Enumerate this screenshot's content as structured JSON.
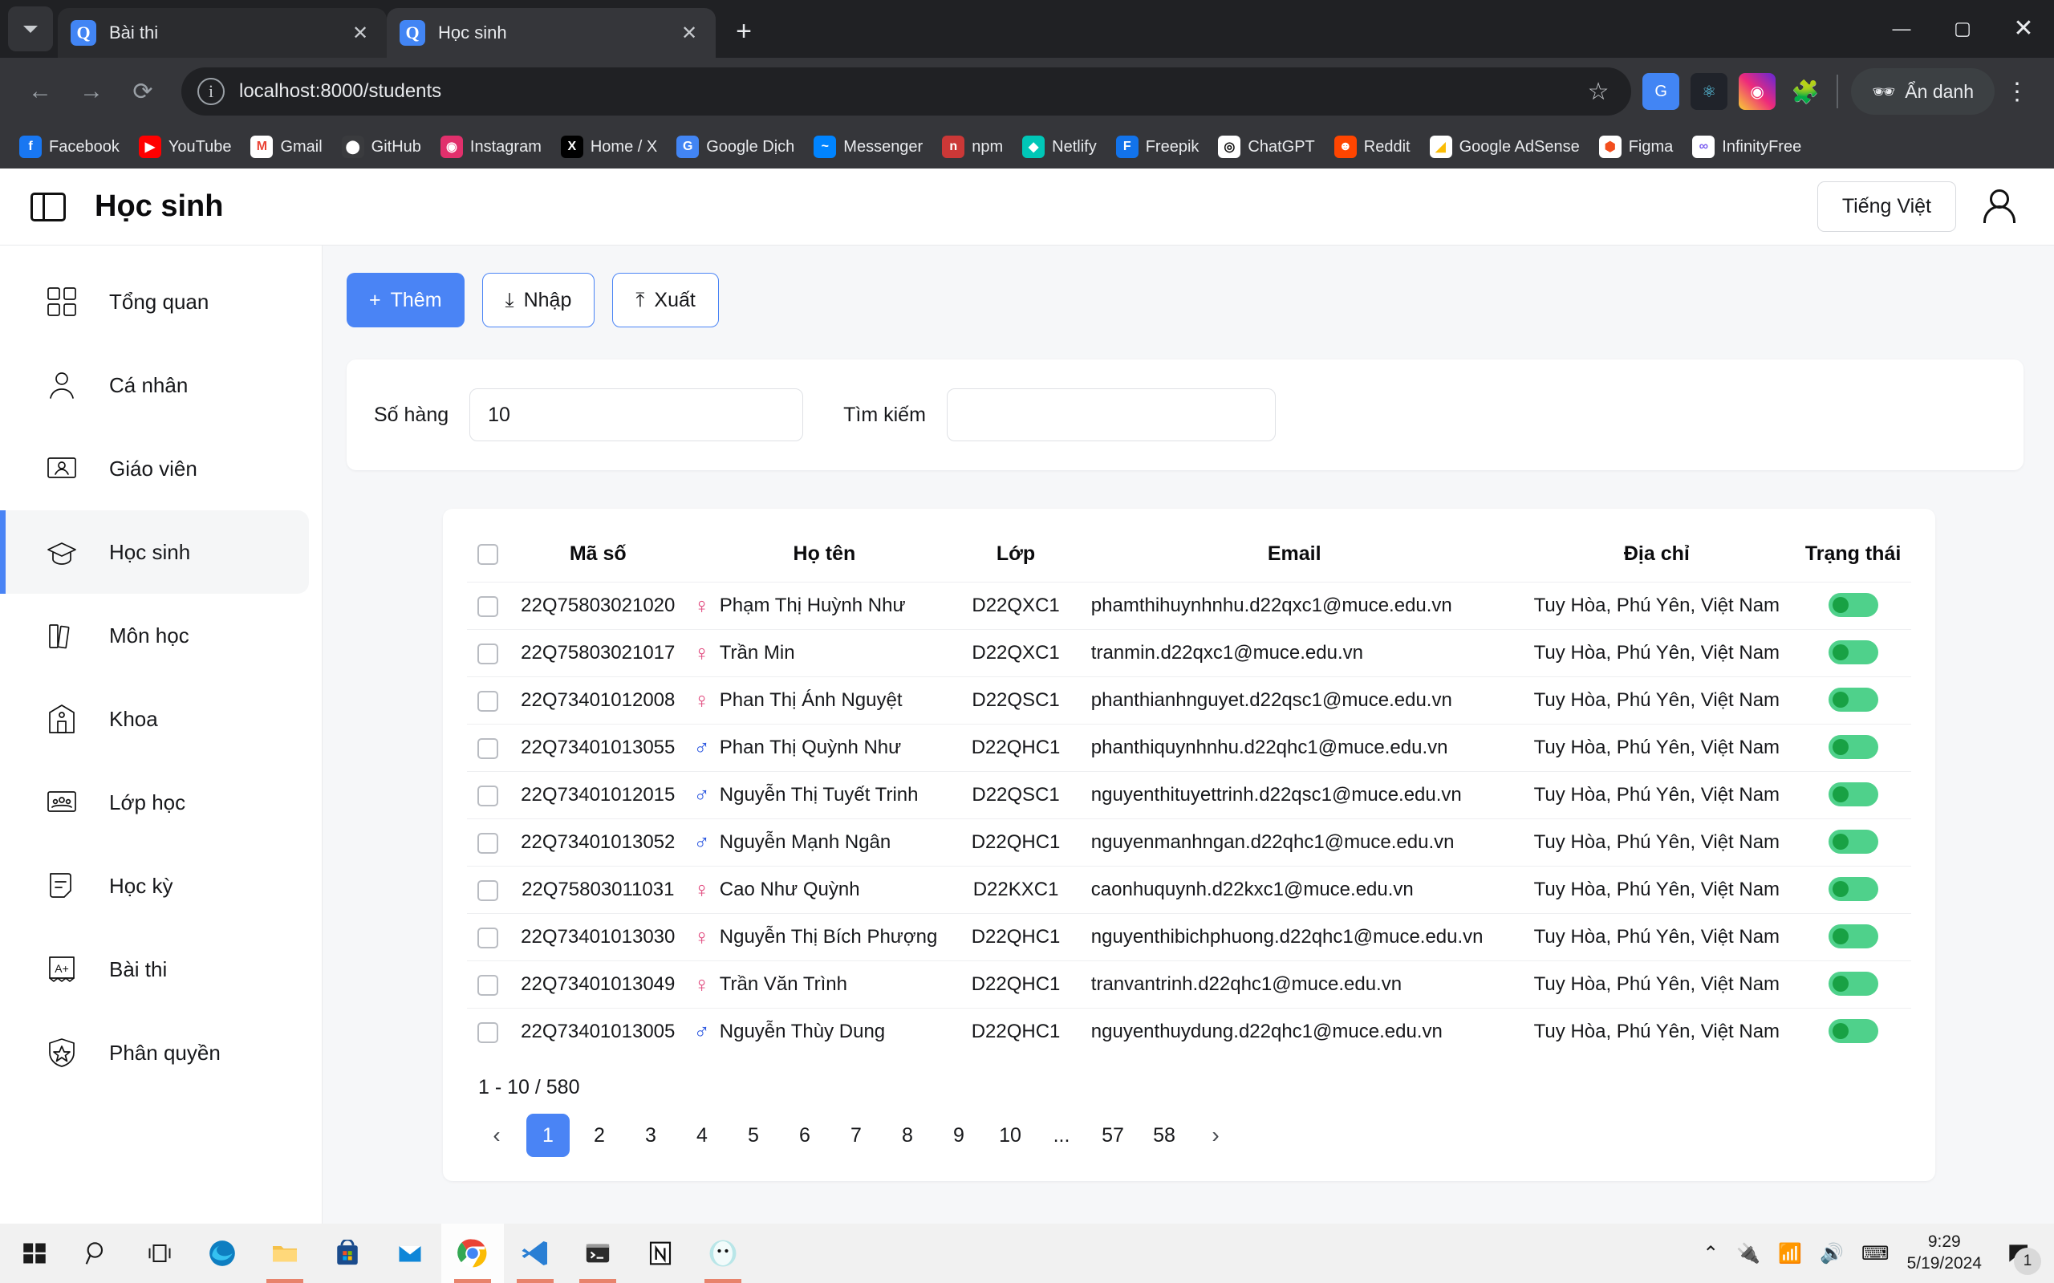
{
  "browser": {
    "tabs": [
      {
        "title": "Bài thi",
        "favicon_letter": "Q",
        "active": false
      },
      {
        "title": "Học sinh",
        "favicon_letter": "Q",
        "active": true
      }
    ],
    "new_tab_label": "+",
    "window_controls": {
      "minimize": "—",
      "maximize": "▢",
      "close": "✕"
    },
    "nav": {
      "back": "←",
      "forward": "→",
      "reload": "⟳"
    },
    "url": "localhost:8000/students",
    "star_label": "☆",
    "incognito_label": "Ẩn danh",
    "kebab_label": "⋮",
    "extensions": [
      "google-translate-icon",
      "react-devtools-icon",
      "instagram-downloader-icon",
      "extensions-puzzle-icon"
    ],
    "bookmarks": [
      {
        "label": "Facebook",
        "glyph": "f",
        "bg": "#1877f2",
        "fg": "#ffffff"
      },
      {
        "label": "YouTube",
        "glyph": "▶",
        "bg": "#ff0000",
        "fg": "#ffffff"
      },
      {
        "label": "Gmail",
        "glyph": "M",
        "bg": "#ffffff",
        "fg": "#ea4335"
      },
      {
        "label": "GitHub",
        "glyph": "⬤",
        "bg": "#3a3b3e",
        "fg": "#ffffff"
      },
      {
        "label": "Instagram",
        "glyph": "◉",
        "bg": "#e1306c",
        "fg": "#ffffff"
      },
      {
        "label": "Home / X",
        "glyph": "X",
        "bg": "#000000",
        "fg": "#ffffff"
      },
      {
        "label": "Google Dịch",
        "glyph": "G",
        "bg": "#4285f4",
        "fg": "#ffffff"
      },
      {
        "label": "Messenger",
        "glyph": "~",
        "bg": "#0084ff",
        "fg": "#ffffff"
      },
      {
        "label": "npm",
        "glyph": "n",
        "bg": "#cb3837",
        "fg": "#ffffff"
      },
      {
        "label": "Netlify",
        "glyph": "◆",
        "bg": "#00c7b7",
        "fg": "#ffffff"
      },
      {
        "label": "Freepik",
        "glyph": "F",
        "bg": "#1273eb",
        "fg": "#ffffff"
      },
      {
        "label": "ChatGPT",
        "glyph": "◎",
        "bg": "#ffffff",
        "fg": "#111111"
      },
      {
        "label": "Reddit",
        "glyph": "☻",
        "bg": "#ff4500",
        "fg": "#ffffff"
      },
      {
        "label": "Google AdSense",
        "glyph": "◢",
        "bg": "#ffffff",
        "fg": "#fbbc04"
      },
      {
        "label": "Figma",
        "glyph": "⬢",
        "bg": "#ffffff",
        "fg": "#f24e1e"
      },
      {
        "label": "InfinityFree",
        "glyph": "∞",
        "bg": "#ffffff",
        "fg": "#7a5cf0"
      }
    ]
  },
  "app": {
    "title": "Học sinh",
    "sidebar_toggle": "panel-toggle-icon",
    "language": "Tiếng Việt",
    "sidebar": [
      {
        "label": "Tổng quan",
        "icon": "grid-icon",
        "active": false
      },
      {
        "label": "Cá nhân",
        "icon": "person-icon",
        "active": false
      },
      {
        "label": "Giáo viên",
        "icon": "teacher-board-icon",
        "active": false
      },
      {
        "label": "Học sinh",
        "icon": "graduation-cap-icon",
        "active": true
      },
      {
        "label": "Môn học",
        "icon": "books-icon",
        "active": false
      },
      {
        "label": "Khoa",
        "icon": "school-building-icon",
        "active": false
      },
      {
        "label": "Lớp học",
        "icon": "classroom-icon",
        "active": false
      },
      {
        "label": "Học kỳ",
        "icon": "note-icon",
        "active": false
      },
      {
        "label": "Bài thi",
        "icon": "grade-sheet-icon",
        "active": false
      },
      {
        "label": "Phân quyền",
        "icon": "auth0-shield-icon",
        "active": false
      }
    ],
    "toolbar": {
      "add_label": "Thêm",
      "add_prefix": "+",
      "import_label": "Nhập",
      "export_label": "Xuất"
    },
    "filters": {
      "rows_label": "Số hàng",
      "rows_value": "10",
      "search_label": "Tìm kiếm",
      "search_value": "",
      "search_placeholder": ""
    },
    "table": {
      "columns": [
        "Mã số",
        "Họ tên",
        "Lớp",
        "Email",
        "Địa chỉ",
        "Trạng thái"
      ],
      "rows": [
        {
          "code": "22Q75803021020",
          "gender": "female",
          "name": "Phạm Thị Huỳnh Như",
          "class": "D22QXC1",
          "email": "phamthihuynhnhu.d22qxc1@muce.edu.vn",
          "address": "Tuy Hòa, Phú Yên, Việt Nam",
          "status": "on"
        },
        {
          "code": "22Q75803021017",
          "gender": "female",
          "name": "Trần Min",
          "class": "D22QXC1",
          "email": "tranmin.d22qxc1@muce.edu.vn",
          "address": "Tuy Hòa, Phú Yên, Việt Nam",
          "status": "on"
        },
        {
          "code": "22Q73401012008",
          "gender": "female",
          "name": "Phan Thị Ánh Nguyệt",
          "class": "D22QSC1",
          "email": "phanthianhnguyet.d22qsc1@muce.edu.vn",
          "address": "Tuy Hòa, Phú Yên, Việt Nam",
          "status": "on"
        },
        {
          "code": "22Q73401013055",
          "gender": "male",
          "name": "Phan Thị Quỳnh Như",
          "class": "D22QHC1",
          "email": "phanthiquynhnhu.d22qhc1@muce.edu.vn",
          "address": "Tuy Hòa, Phú Yên, Việt Nam",
          "status": "on"
        },
        {
          "code": "22Q73401012015",
          "gender": "male",
          "name": "Nguyễn Thị Tuyết Trinh",
          "class": "D22QSC1",
          "email": "nguyenthituyettrinh.d22qsc1@muce.edu.vn",
          "address": "Tuy Hòa, Phú Yên, Việt Nam",
          "status": "on"
        },
        {
          "code": "22Q73401013052",
          "gender": "male",
          "name": "Nguyễn Mạnh Ngân",
          "class": "D22QHC1",
          "email": "nguyenmanhngan.d22qhc1@muce.edu.vn",
          "address": "Tuy Hòa, Phú Yên, Việt Nam",
          "status": "on"
        },
        {
          "code": "22Q75803011031",
          "gender": "female",
          "name": "Cao Như Quỳnh",
          "class": "D22KXC1",
          "email": "caonhuquynh.d22kxc1@muce.edu.vn",
          "address": "Tuy Hòa, Phú Yên, Việt Nam",
          "status": "on"
        },
        {
          "code": "22Q73401013030",
          "gender": "female",
          "name": "Nguyễn Thị Bích Phượng",
          "class": "D22QHC1",
          "email": "nguyenthibichphuong.d22qhc1@muce.edu.vn",
          "address": "Tuy Hòa, Phú Yên, Việt Nam",
          "status": "on"
        },
        {
          "code": "22Q73401013049",
          "gender": "female",
          "name": "Trần Văn Trình",
          "class": "D22QHC1",
          "email": "tranvantrinh.d22qhc1@muce.edu.vn",
          "address": "Tuy Hòa, Phú Yên, Việt Nam",
          "status": "on"
        },
        {
          "code": "22Q73401013005",
          "gender": "male",
          "name": "Nguyễn Thùy Dung",
          "class": "D22QHC1",
          "email": "nguyenthuydung.d22qhc1@muce.edu.vn",
          "address": "Tuy Hòa, Phú Yên, Việt Nam",
          "status": "on"
        }
      ]
    },
    "pagination": {
      "info": "1 - 10 / 580",
      "prev": "‹",
      "next": "›",
      "pages": [
        "1",
        "2",
        "3",
        "4",
        "5",
        "6",
        "7",
        "8",
        "9",
        "10",
        "...",
        "57",
        "58"
      ],
      "current": "1"
    },
    "colors": {
      "accent": "#4a84f5",
      "status_on": "#4fd18b",
      "status_knob": "#18a144",
      "female": "#e0457b",
      "male": "#2b57e0"
    }
  },
  "taskbar": {
    "items": [
      "windows-start-icon",
      "search-icon",
      "task-view-icon",
      "edge-icon",
      "file-explorer-icon",
      "microsoft-store-icon",
      "mail-icon",
      "chrome-icon",
      "vscode-icon",
      "terminal-icon",
      "notion-icon",
      "zalo-icon"
    ],
    "tray": [
      "show-hidden-icons",
      "battery-charging-icon",
      "wifi-icon",
      "volume-icon",
      "keyboard-icon"
    ],
    "time": "9:29",
    "date": "5/19/2024",
    "notification_count": "1"
  }
}
